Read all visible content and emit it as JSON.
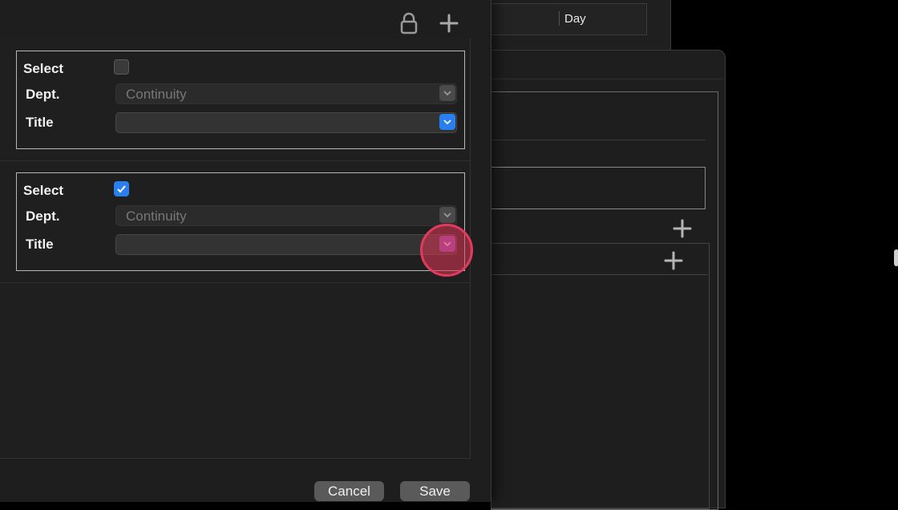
{
  "background_window": {
    "table_column_day": "Day"
  },
  "sheet": {
    "toolbar": {
      "lock_icon": "lock-icon",
      "add_icon": "plus-icon"
    },
    "groups": [
      {
        "select_label": "Select",
        "select_checked": false,
        "dept_label": "Dept.",
        "dept_value": "Continuity",
        "title_label": "Title",
        "title_value": ""
      },
      {
        "select_label": "Select",
        "select_checked": true,
        "dept_label": "Dept.",
        "dept_value": "Continuity",
        "title_label": "Title",
        "title_value": ""
      }
    ],
    "buttons": {
      "cancel": "Cancel",
      "save": "Save"
    }
  },
  "colors": {
    "accent": "#2a7ff0",
    "click_indicator": "#e23a5e"
  }
}
